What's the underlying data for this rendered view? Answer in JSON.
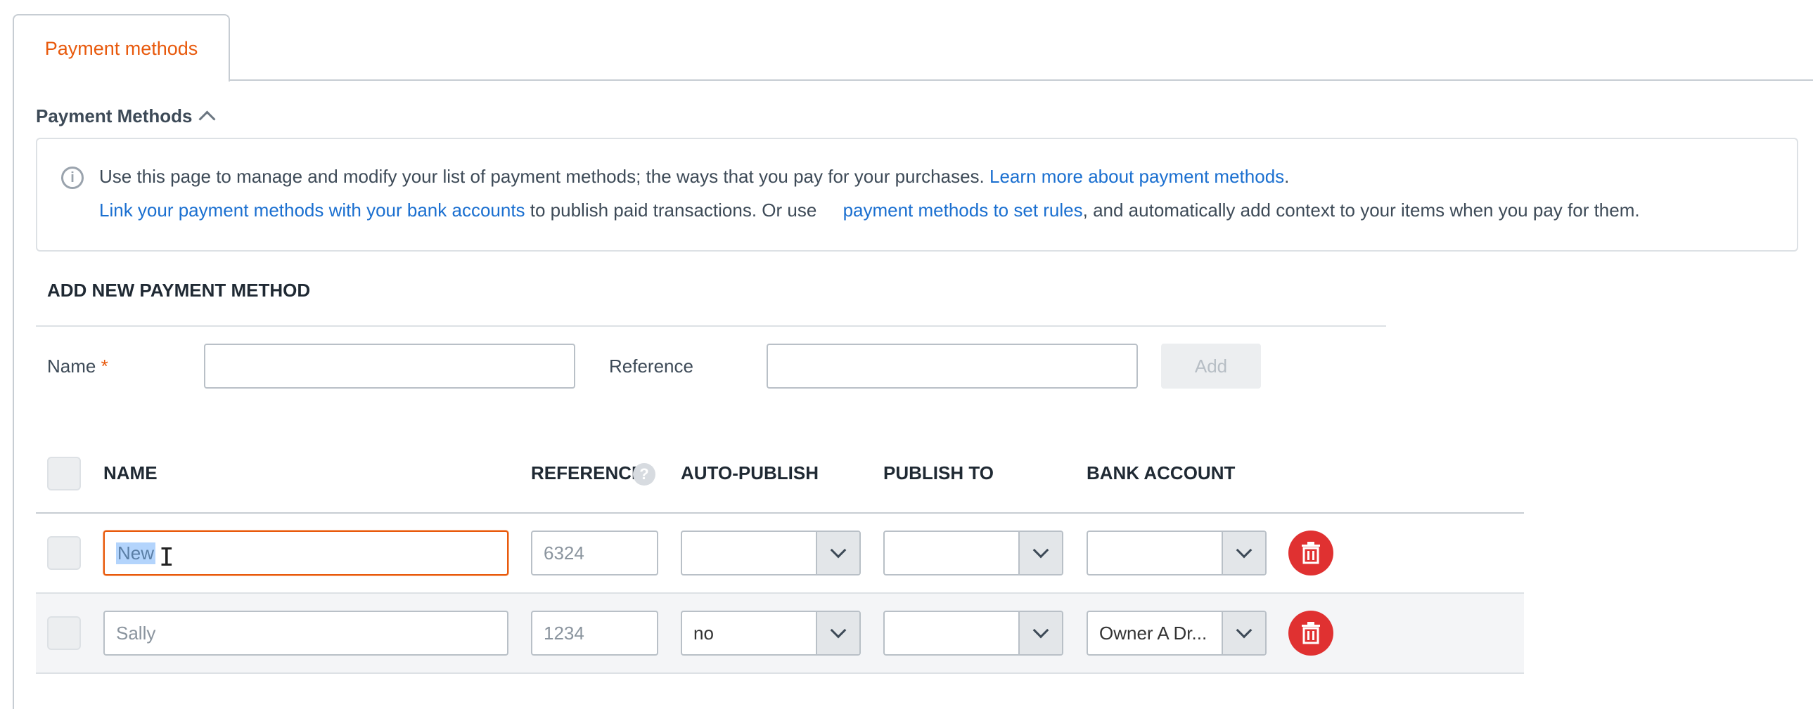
{
  "tabs": {
    "active_label": "Payment methods"
  },
  "section": {
    "title": "Payment Methods"
  },
  "info": {
    "line1_text": "Use this page to manage and modify your list of payment methods; the ways that you pay for your purchases. ",
    "line1_link": "Learn more about payment methods",
    "line1_end": ".",
    "line2_link1": "Link your payment methods with your bank accounts",
    "line2_mid": " to publish paid transactions. Or use ",
    "line2_link2": "payment methods to set rules",
    "line2_end": ", and automatically add context to your items when you pay for them."
  },
  "add_form": {
    "title": "ADD NEW PAYMENT METHOD",
    "name_label": "Name",
    "required_mark": "*",
    "reference_label": "Reference",
    "name_value": "",
    "reference_value": "",
    "add_button": "Add"
  },
  "table": {
    "headers": {
      "name": "NAME",
      "reference": "REFERENCE",
      "reference_help": "?",
      "auto_publish": "AUTO-PUBLISH",
      "publish_to": "PUBLISH TO",
      "bank_account": "BANK ACCOUNT"
    },
    "rows": [
      {
        "name": "New",
        "reference": "6324",
        "auto_publish": "",
        "publish_to": "",
        "bank_account": ""
      },
      {
        "name": "Sally",
        "reference": "1234",
        "auto_publish": "no",
        "publish_to": "",
        "bank_account": "Owner A Dr..."
      }
    ]
  },
  "colors": {
    "accent": "#e8590c",
    "link": "#1a6fd0",
    "delete": "#e03131"
  }
}
